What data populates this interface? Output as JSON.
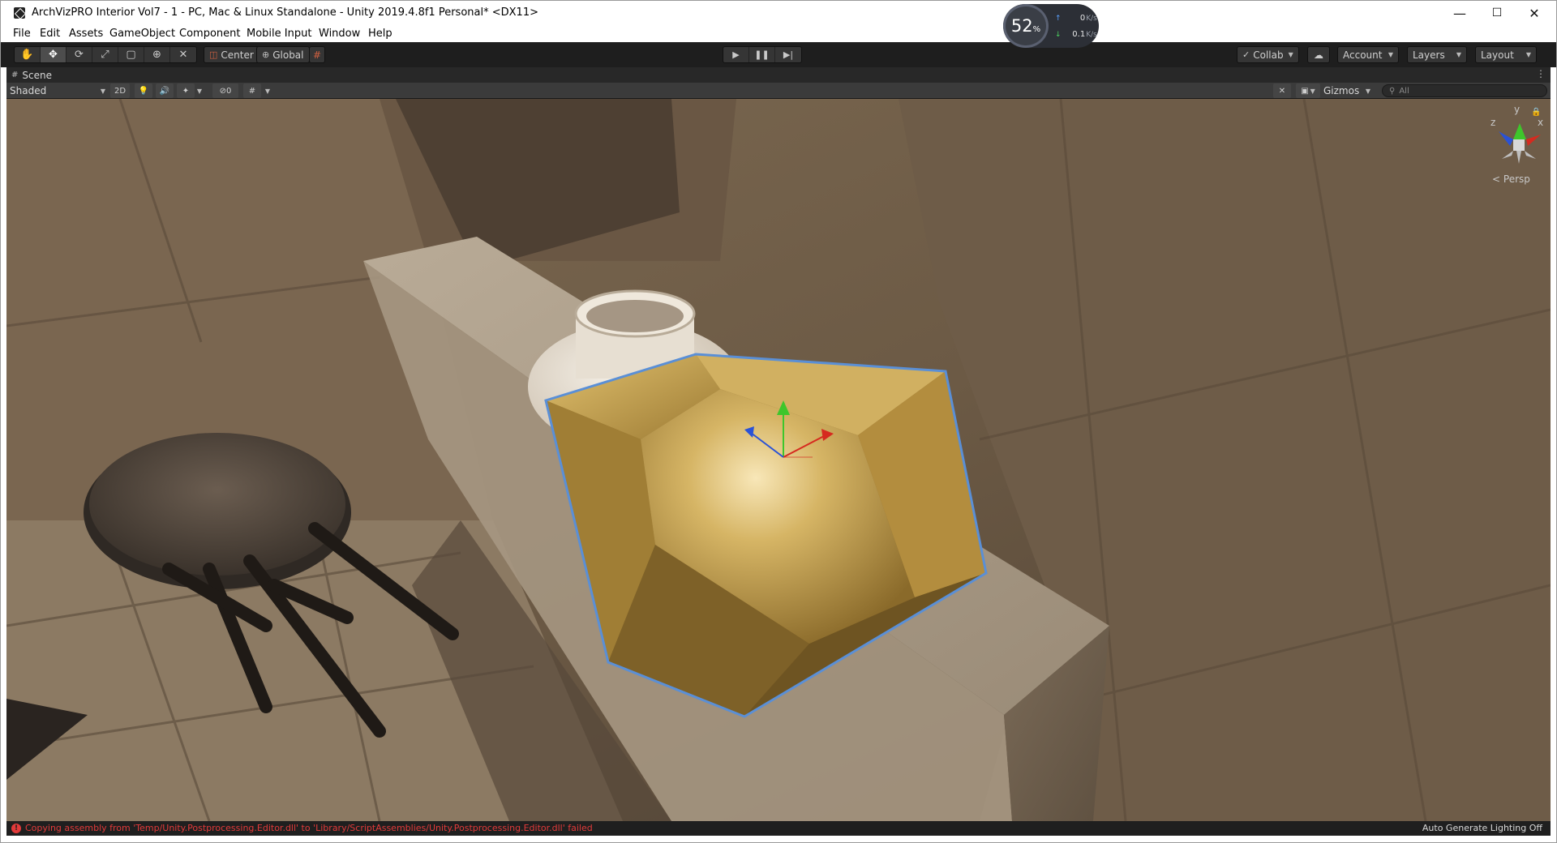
{
  "window": {
    "title": "ArchVizPRO Interior Vol7 - 1 - PC, Mac & Linux Standalone - Unity 2019.4.8f1 Personal* <DX11>",
    "minimize": "—",
    "maximize": "☐",
    "close": "✕"
  },
  "perf": {
    "percent": "52",
    "percent_unit": "%",
    "upload_value": "0",
    "upload_unit": "K/s",
    "download_value": "0.1",
    "download_unit": "K/s"
  },
  "menu": [
    "File",
    "Edit",
    "Assets",
    "GameObject",
    "Component",
    "Mobile Input",
    "Window",
    "Help"
  ],
  "toolbar": {
    "pivot_label": "Center",
    "space_label": "Global",
    "collab_label": "Collab",
    "account_label": "Account",
    "layers_label": "Layers",
    "layout_label": "Layout"
  },
  "scene_tab": {
    "label": "Scene"
  },
  "scene_toolbar": {
    "draw_mode": "Shaded",
    "mode_2d": "2D",
    "hidden_count": "0",
    "gizmos_label": "Gizmos",
    "search_placeholder": "All"
  },
  "orientation_gizmo": {
    "x_label": "x",
    "y_label": "y",
    "z_label": "z",
    "projection_label": "Persp"
  },
  "status": {
    "error_message": "Copying assembly from 'Temp/Unity.Postprocessing.Editor.dll' to 'Library/ScriptAssemblies/Unity.Postprocessing.Editor.dll' failed",
    "lighting_status": "Auto Generate Lighting Off"
  },
  "colors": {
    "selection_outline": "#5a8fd6",
    "axis_x": "#d62a1f",
    "axis_y": "#3ec62b",
    "axis_z": "#2a52d6",
    "error": "#e23a3a",
    "gold": "#c9a24a"
  }
}
